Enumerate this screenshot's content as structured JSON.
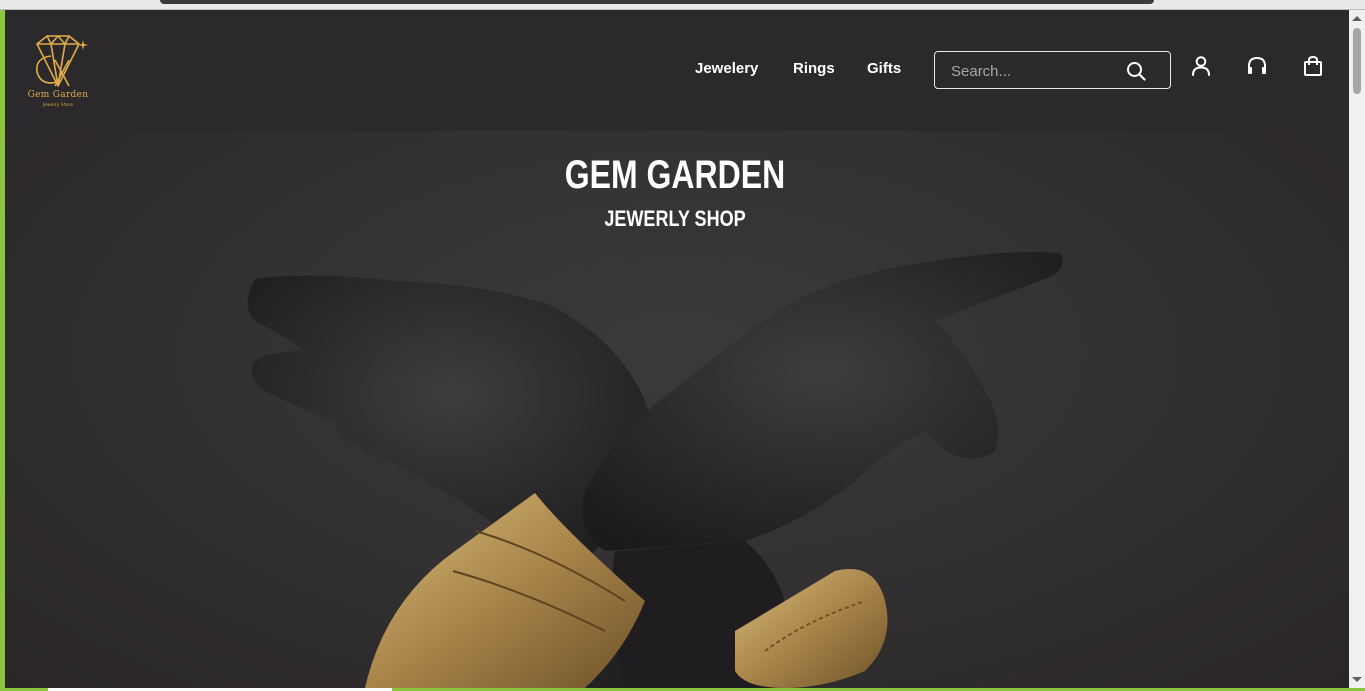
{
  "brand": {
    "name": "Gem Garden",
    "tagline": "Jewelry Store",
    "accent_color": "#e2ad48"
  },
  "nav": {
    "items": [
      {
        "label": "Jewelery"
      },
      {
        "label": "Rings"
      },
      {
        "label": "Gifts"
      }
    ]
  },
  "search": {
    "placeholder": "Search...",
    "value": ""
  },
  "header_icons": [
    "user-icon",
    "headphones-icon",
    "shopping-bag-icon"
  ],
  "hero": {
    "title": "GEM GARDEN",
    "subtitle": "JEWERLY SHOP"
  }
}
